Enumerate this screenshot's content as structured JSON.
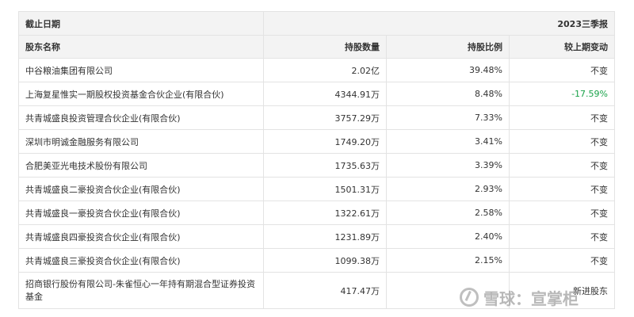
{
  "header": {
    "date_label": "截止日期",
    "period": "2023三季报"
  },
  "columns": {
    "name": "股东名称",
    "shares": "持股数量",
    "ratio": "持股比例",
    "change": "较上期变动"
  },
  "rows": [
    {
      "name": "中谷粮油集团有限公司",
      "shares": "2.02亿",
      "ratio": "39.48%",
      "change": "不变"
    },
    {
      "name": "上海复星惟实一期股权投资基金合伙企业(有限合伙)",
      "shares": "4344.91万",
      "ratio": "8.48%",
      "change": "-17.59%"
    },
    {
      "name": "共青城盛良投资管理合伙企业(有限合伙)",
      "shares": "3757.29万",
      "ratio": "7.33%",
      "change": "不变"
    },
    {
      "name": "深圳市明诚金融服务有限公司",
      "shares": "1749.20万",
      "ratio": "3.41%",
      "change": "不变"
    },
    {
      "name": "合肥美亚光电技术股份有限公司",
      "shares": "1735.63万",
      "ratio": "3.39%",
      "change": "不变"
    },
    {
      "name": "共青城盛良二豪投资合伙企业(有限合伙)",
      "shares": "1501.31万",
      "ratio": "2.93%",
      "change": "不变"
    },
    {
      "name": "共青城盛良一豪投资合伙企业(有限合伙)",
      "shares": "1322.61万",
      "ratio": "2.58%",
      "change": "不变"
    },
    {
      "name": "共青城盛良四豪投资合伙企业(有限合伙)",
      "shares": "1231.89万",
      "ratio": "2.40%",
      "change": "不变"
    },
    {
      "name": "共青城盛良三豪投资合伙企业(有限合伙)",
      "shares": "1099.38万",
      "ratio": "2.15%",
      "change": "不变"
    },
    {
      "name": "招商银行股份有限公司-朱雀恒心一年持有期混合型证券投资基金",
      "shares": "417.47万",
      "ratio": "",
      "change": "新进股东"
    }
  ],
  "watermark": {
    "text": "雪球：宣掌柜"
  },
  "colors": {
    "negative": "#1aa34a",
    "header_bg": "#f3f3f3",
    "border": "#e3e3e3"
  }
}
